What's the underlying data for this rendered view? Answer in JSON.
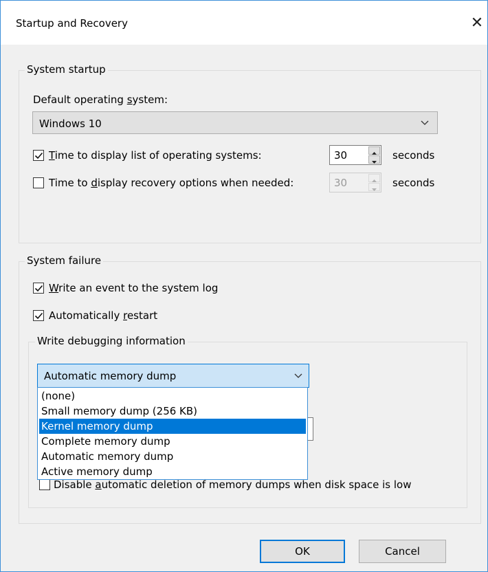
{
  "dialog": {
    "title": "Startup and Recovery",
    "close_icon": "close-icon"
  },
  "system_startup": {
    "legend": "System startup",
    "default_os_label_pre": "Default operating ",
    "default_os_label_key": "s",
    "default_os_label_post": "ystem:",
    "default_os_value": "Windows 10",
    "time_list": {
      "checked": true,
      "label_key": "T",
      "label_post": "ime to display list of operating systems:",
      "value": "30",
      "unit": "seconds"
    },
    "time_recovery": {
      "checked": false,
      "label_pre": "Time to ",
      "label_key": "d",
      "label_post": "isplay recovery options when needed:",
      "value": "30",
      "unit": "seconds",
      "enabled": false
    }
  },
  "system_failure": {
    "legend": "System failure",
    "write_event": {
      "checked": true,
      "label_key": "W",
      "label_post": "rite an event to the system log"
    },
    "auto_restart": {
      "checked": true,
      "label_pre": "Automatically ",
      "label_key": "r",
      "label_post": "estart"
    },
    "debug_group": {
      "legend": "Write debugging information",
      "selected": "Automatic memory dump",
      "options": [
        "(none)",
        "Small memory dump (256 KB)",
        "Kernel memory dump",
        "Complete memory dump",
        "Automatic memory dump",
        "Active memory dump"
      ],
      "highlighted_option": "Kernel memory dump",
      "disable_auto_delete": {
        "checked": false,
        "label_pre": "Disable ",
        "label_key": "a",
        "label_post": "utomatic deletion of memory dumps when disk space is low"
      }
    }
  },
  "buttons": {
    "ok": "OK",
    "cancel": "Cancel"
  },
  "colors": {
    "accent": "#0078d7",
    "window_border": "#3c8fd8",
    "dialog_bg": "#f0f0f0"
  }
}
